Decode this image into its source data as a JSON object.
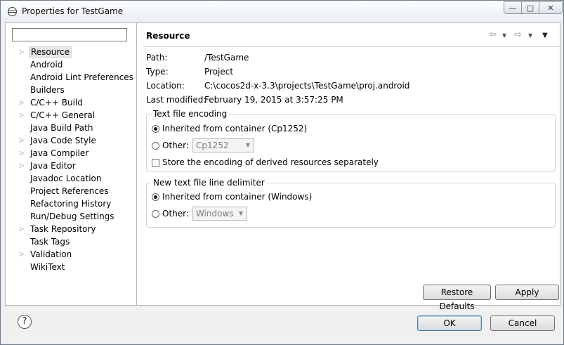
{
  "window": {
    "title": "Properties for TestGame"
  },
  "filter": {
    "value": ""
  },
  "tree": [
    {
      "label": "Resource",
      "expandable": true,
      "selected": true
    },
    {
      "label": "Android",
      "expandable": false
    },
    {
      "label": "Android Lint Preferences",
      "expandable": false
    },
    {
      "label": "Builders",
      "expandable": false
    },
    {
      "label": "C/C++ Build",
      "expandable": true
    },
    {
      "label": "C/C++ General",
      "expandable": true
    },
    {
      "label": "Java Build Path",
      "expandable": false
    },
    {
      "label": "Java Code Style",
      "expandable": true
    },
    {
      "label": "Java Compiler",
      "expandable": true
    },
    {
      "label": "Java Editor",
      "expandable": true
    },
    {
      "label": "Javadoc Location",
      "expandable": false
    },
    {
      "label": "Project References",
      "expandable": false
    },
    {
      "label": "Refactoring History",
      "expandable": false
    },
    {
      "label": "Run/Debug Settings",
      "expandable": false
    },
    {
      "label": "Task Repository",
      "expandable": true
    },
    {
      "label": "Task Tags",
      "expandable": false
    },
    {
      "label": "Validation",
      "expandable": true
    },
    {
      "label": "WikiText",
      "expandable": false
    }
  ],
  "page": {
    "title": "Resource",
    "info": {
      "path_label": "Path:",
      "path_value": "/TestGame",
      "type_label": "Type:",
      "type_value": "Project",
      "location_label": "Location:",
      "location_value": "C:\\cocos2d-x-3.3\\projects\\TestGame\\proj.android",
      "modified_label": "Last modified:",
      "modified_value": "February 19, 2015 at 3:57:25 PM"
    },
    "encoding": {
      "title": "Text file encoding",
      "inherited_label": "Inherited from container (Cp1252)",
      "other_label": "Other:",
      "other_value": "Cp1252",
      "store_label": "Store the encoding of derived resources separately"
    },
    "delimiter": {
      "title": "New text file line delimiter",
      "inherited_label": "Inherited from container (Windows)",
      "other_label": "Other:",
      "other_value": "Windows"
    },
    "restore_label": "Restore Defaults",
    "apply_label": "Apply"
  },
  "footer": {
    "ok_label": "OK",
    "cancel_label": "Cancel"
  }
}
